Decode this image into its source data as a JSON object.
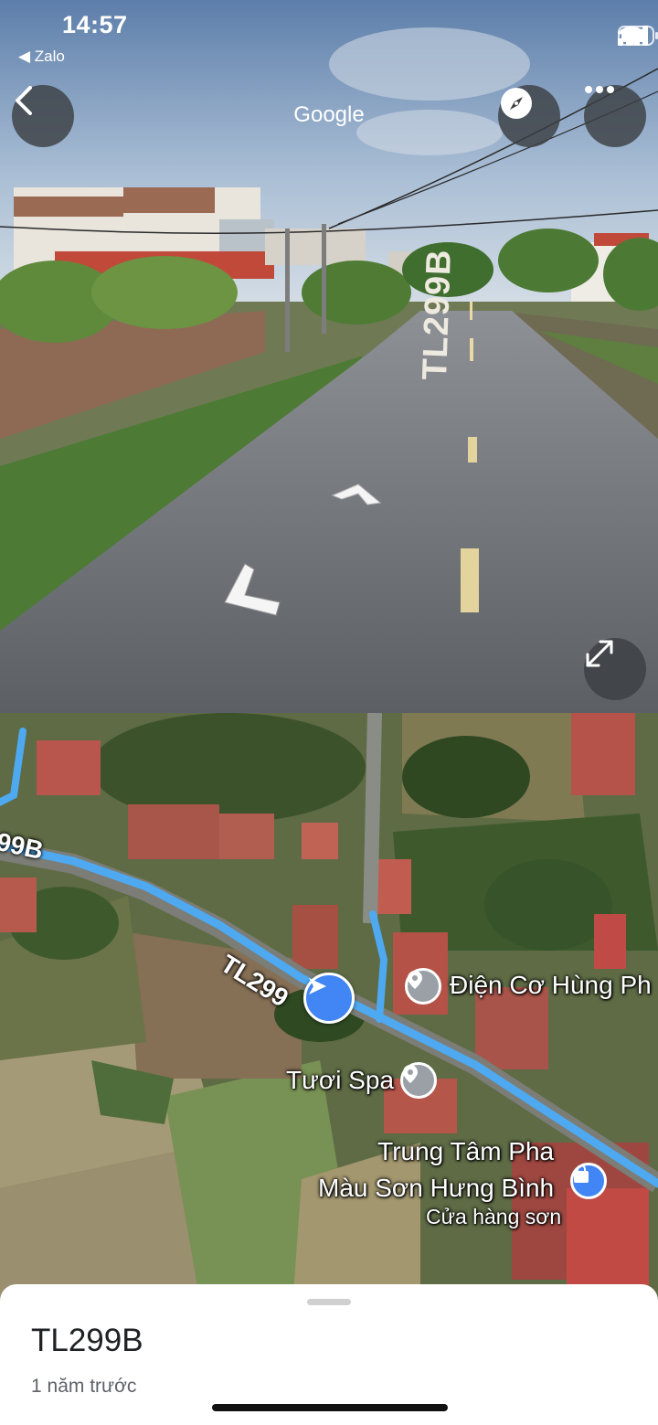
{
  "status_bar": {
    "time": "14:57",
    "back_app": "◀ Zalo"
  },
  "street_view": {
    "title": "Google",
    "road_marking": "TL299B"
  },
  "map": {
    "road_labels": [
      "99B",
      "TL299"
    ],
    "places": [
      {
        "name": "Điện Cơ Hùng Ph"
      },
      {
        "name": "Tươi Spa"
      },
      {
        "name": "Trung Tâm Pha\nMàu Sơn Hưng Bình",
        "category": "Cửa hàng sơn"
      }
    ]
  },
  "sheet": {
    "title": "TL299B",
    "subtitle": "1 năm trước"
  },
  "colors": {
    "route": "#4ea9f0",
    "marker": "#4285f4",
    "pin": "#9aa0a6"
  }
}
